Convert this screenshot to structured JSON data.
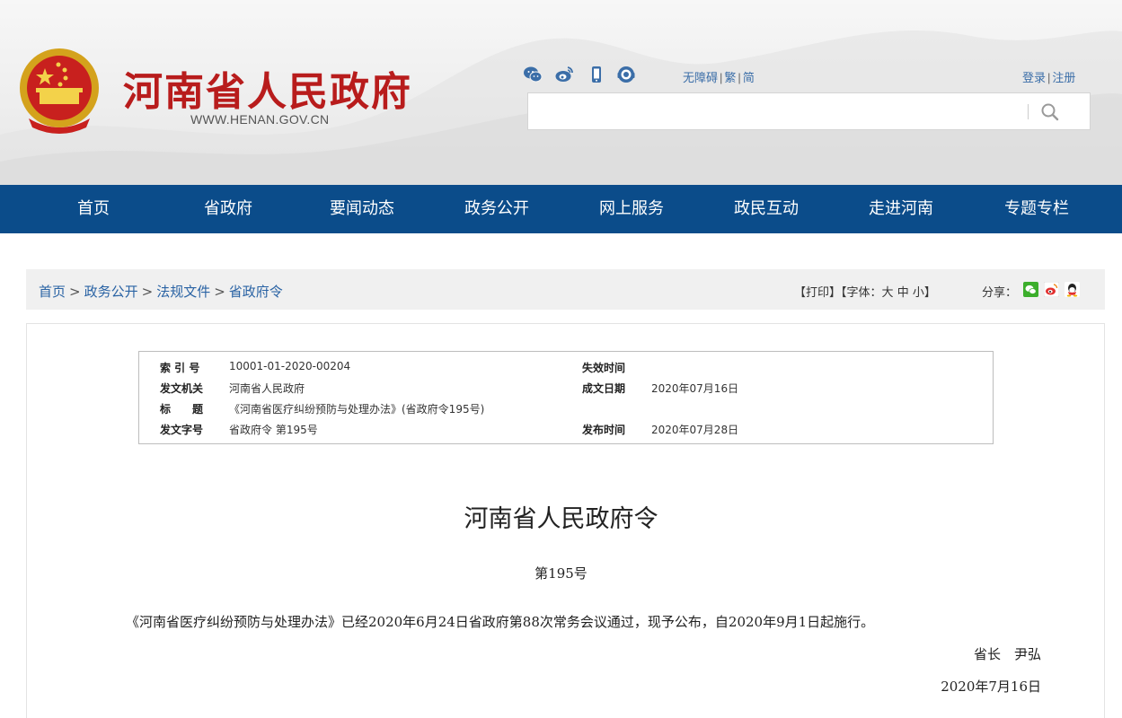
{
  "header": {
    "title": "河南省人民政府",
    "url": "WWW.HENAN.GOV.CN",
    "social_icons": [
      "wechat-icon",
      "weibo-icon",
      "mobile-icon",
      "headset-icon"
    ],
    "lang_links": [
      "无障碍",
      "繁",
      "简"
    ],
    "auth_links": [
      "登录",
      "注册"
    ],
    "search": {
      "placeholder": ""
    }
  },
  "nav": {
    "items": [
      "首页",
      "省政府",
      "要闻动态",
      "政务公开",
      "网上服务",
      "政民互动",
      "走进河南",
      "专题专栏"
    ]
  },
  "breadcrumb": {
    "items": [
      "首页",
      "政务公开",
      "法规文件",
      "省政府令"
    ],
    "separator": ">"
  },
  "tools": {
    "print": "【打印】",
    "font_prefix": "【字体：",
    "font_large": "大",
    "font_medium": "中",
    "font_small": "小",
    "font_suffix": "】",
    "share_label": "分享："
  },
  "meta": {
    "index_label": "索 引 号",
    "index_value": "10001-01-2020-00204",
    "expire_label": "失效时间",
    "expire_value": "",
    "issuer_label": "发文机关",
    "issuer_value": "河南省人民政府",
    "written_label": "成文日期",
    "written_value": "2020年07月16日",
    "title_label": "标　　题",
    "title_value": "《河南省医疗纠纷预防与处理办法》(省政府令195号)",
    "docno_label": "发文字号",
    "docno_value": "省政府令 第195号",
    "publish_label": "发布时间",
    "publish_value": "2020年07月28日"
  },
  "document": {
    "title": "河南省人民政府令",
    "number": "第195号",
    "body": "《河南省医疗纠纷预防与处理办法》已经2020年6月24日省政府第88次常务会议通过，现予公布，自2020年9月1日起施行。",
    "signature": "省长　尹弘",
    "date": "2020年7月16日"
  },
  "colors": {
    "nav_bg": "#0b4c8a",
    "title_red": "#b81c1c",
    "link_blue": "#2a63a4"
  }
}
